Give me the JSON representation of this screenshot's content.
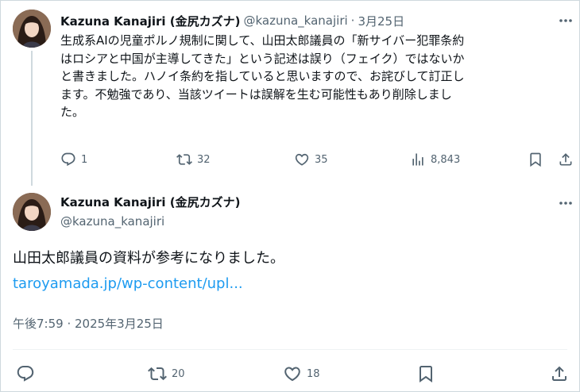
{
  "tweet1": {
    "author_name": "Kazuna Kanajiri (金尻カズナ)",
    "handle": "@kazuna_kanajiri",
    "separator": "·",
    "date": "3月25日",
    "text": "生成系AIの児童ポルノ規制に関して、山田太郎議員の「新サイバー犯罪条約\nはロシアと中国が主導してきた」という記述は誤り（フェイク）ではないか\nと書きました。ハノイ条約を指していると思いますので、お詫びして訂正し\nます。不勉強であり、当該ツイートは誤解を生む可能性もあり削除しまし\nた。",
    "replies": "1",
    "reposts": "32",
    "likes": "35",
    "views": "8,843"
  },
  "tweet2": {
    "author_name": "Kazuna Kanajiri (金尻カズナ)",
    "handle": "@kazuna_kanajiri",
    "text": "山田太郎議員の資料が参考になりました。",
    "link": "taroyamada.jp/wp-content/upl...",
    "timestamp": "午後7:59 · 2025年3月25日",
    "replies": "",
    "reposts": "20",
    "likes": "18"
  },
  "icons": {
    "reply": "speech-bubble-icon",
    "repost": "repost-arrows-icon",
    "like": "heart-icon",
    "views": "bar-chart-icon",
    "bookmark": "bookmark-icon",
    "share": "share-upload-icon",
    "more": "more-dots-icon"
  },
  "colors": {
    "link": "#1d9bf0",
    "secondary_text": "#536471",
    "primary_text": "#0f1419",
    "border": "#cfd9de"
  }
}
